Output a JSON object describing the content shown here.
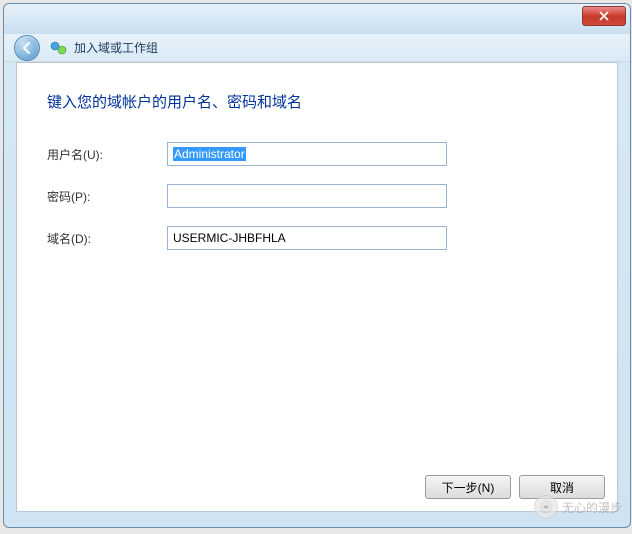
{
  "header": {
    "title": "加入域或工作组"
  },
  "content": {
    "instruction": "键入您的域帐户的用户名、密码和域名",
    "labels": {
      "username": "用户名(U):",
      "password": "密码(P):",
      "domain": "域名(D):"
    },
    "values": {
      "username": "Administrator",
      "password": "",
      "domain": "USERMIC-JHBFHLA"
    }
  },
  "footer": {
    "next": "下一步(N)",
    "cancel": "取消"
  },
  "watermark": {
    "text": "无心的漫步"
  }
}
